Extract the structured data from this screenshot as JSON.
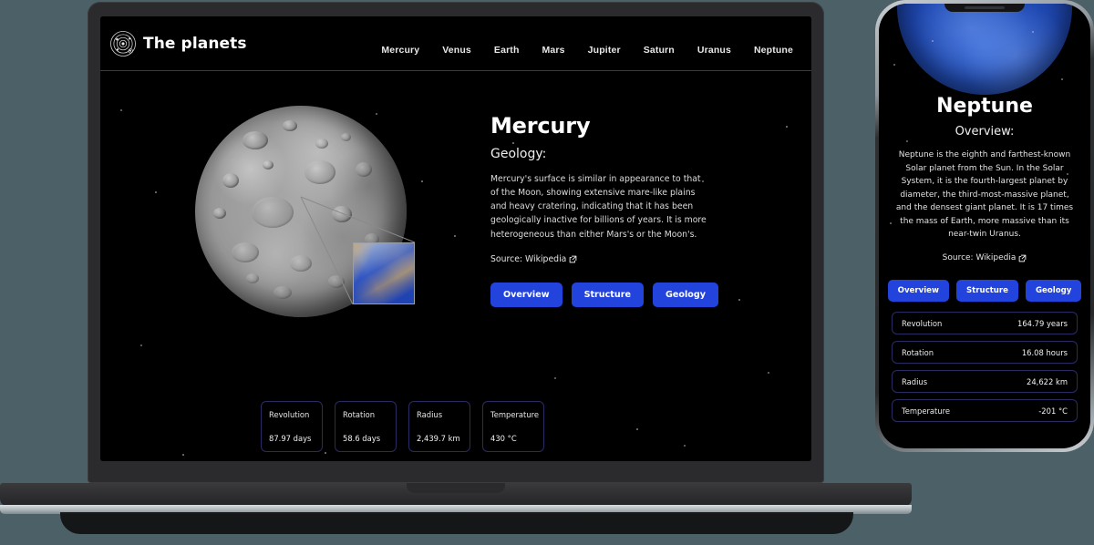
{
  "site": {
    "brand": {
      "name": "The planets",
      "logo_icon": "solar-system-icon"
    },
    "nav": [
      {
        "label": "Mercury"
      },
      {
        "label": "Venus"
      },
      {
        "label": "Earth"
      },
      {
        "label": "Mars"
      },
      {
        "label": "Jupiter"
      },
      {
        "label": "Saturn"
      },
      {
        "label": "Uranus"
      },
      {
        "label": "Neptune"
      }
    ],
    "planet": {
      "name": "Mercury",
      "section": "Geology:",
      "description": "Mercury's surface is similar in appearance to that of the Moon, showing extensive mare-like plains and heavy cratering, indicating that it has been geologically inactive for billions of years. It is more heterogeneous than either Mars's or the Moon's.",
      "source": "Source: Wikipedia",
      "source_icon": "external-link-icon"
    },
    "tabs": [
      {
        "label": "Overview"
      },
      {
        "label": "Structure"
      },
      {
        "label": "Geology"
      }
    ],
    "stats": [
      {
        "label": "Revolution",
        "value": "87.97 days"
      },
      {
        "label": "Rotation",
        "value": "58.6 days"
      },
      {
        "label": "Radius",
        "value": "2,439.7 km"
      },
      {
        "label": "Temperature",
        "value": "430 °C"
      }
    ]
  },
  "phone": {
    "planet": {
      "name": "Neptune",
      "section": "Overview:",
      "description": "Neptune is the eighth and farthest-known Solar planet from the Sun. In the Solar System, it is the fourth-largest planet by diameter, the third-most-massive planet, and the densest giant planet. It is 17 times the mass of Earth, more massive than its near-twin Uranus.",
      "source": "Source: Wikipedia",
      "source_icon": "external-link-icon"
    },
    "tabs": [
      {
        "label": "Overview"
      },
      {
        "label": "Structure"
      },
      {
        "label": "Geology"
      }
    ],
    "stats": [
      {
        "label": "Revolution",
        "value": "164.79 years"
      },
      {
        "label": "Rotation",
        "value": "16.08 hours"
      },
      {
        "label": "Radius",
        "value": "24,622 km"
      },
      {
        "label": "Temperature",
        "value": "-201 °C"
      }
    ]
  },
  "colors": {
    "page_background": "#4c6068",
    "screen_background": "#000000",
    "accent_button": "#2244dd",
    "stat_border": "#2b2b63"
  }
}
